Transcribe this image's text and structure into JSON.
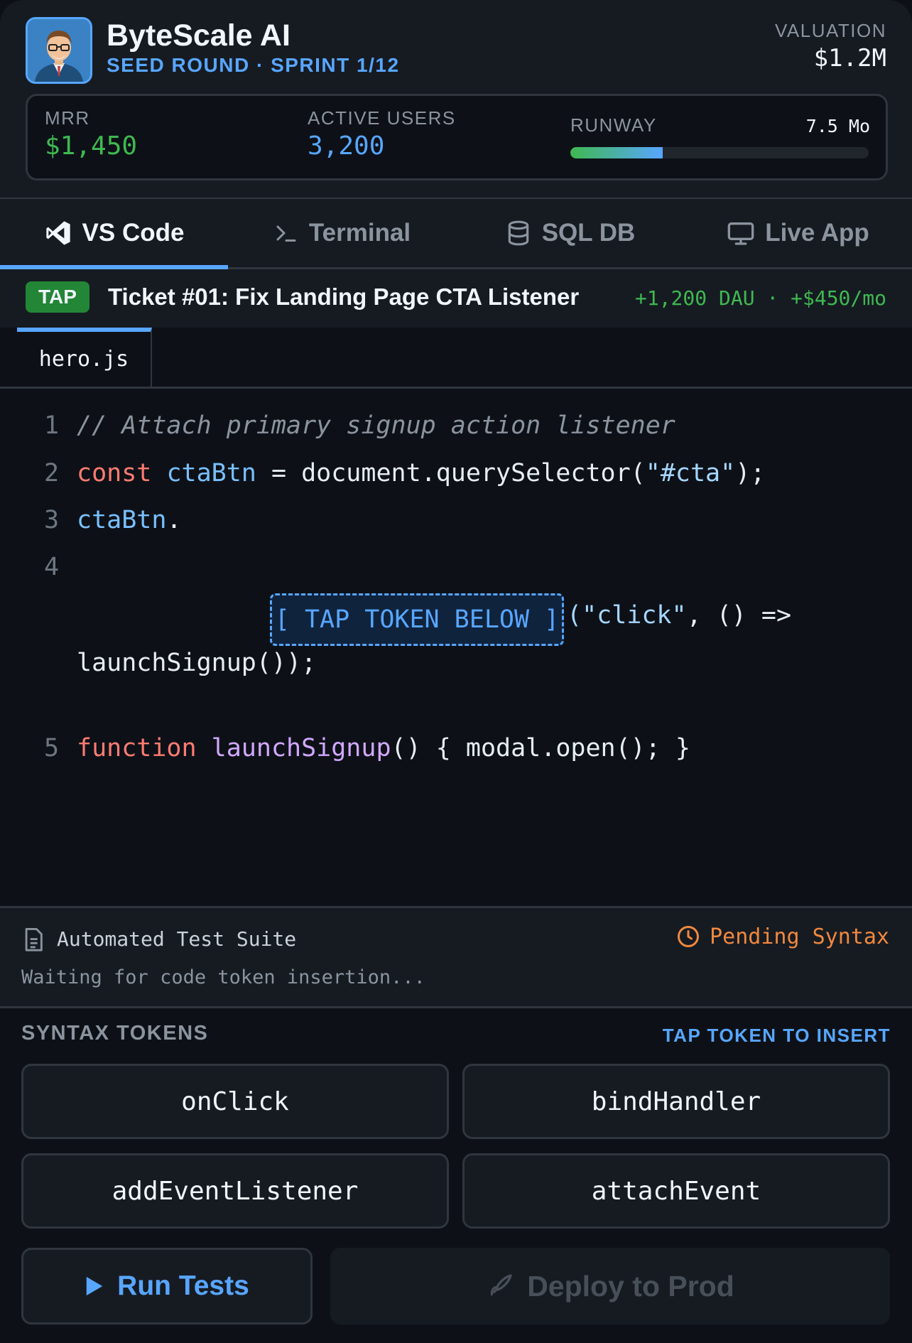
{
  "header": {
    "company_name": "ByteScale AI",
    "round": "SEED ROUND · SPRINT 1/12",
    "valuation_label": "VALUATION",
    "valuation_value": "$1.2M"
  },
  "stats": {
    "mrr_label": "MRR",
    "mrr_value": "$1,450",
    "users_label": "ACTIVE USERS",
    "users_value": "3,200",
    "runway_label": "RUNWAY",
    "runway_value": "7.5 Mo",
    "runway_fill_fraction": 0.31
  },
  "tabs": [
    {
      "label": "VS Code",
      "icon": "vscode-icon",
      "active": true
    },
    {
      "label": "Terminal",
      "icon": "terminal-icon",
      "active": false
    },
    {
      "label": "SQL DB",
      "icon": "database-icon",
      "active": false
    },
    {
      "label": "Live App",
      "icon": "monitor-icon",
      "active": false
    }
  ],
  "ticket": {
    "badge": "TAP",
    "title": "Ticket #01: Fix Landing Page CTA Listener",
    "reward": "+1,200 DAU · +$450/mo"
  },
  "file_tab": "hero.js",
  "code": {
    "line_numbers": [
      "1",
      "2",
      "3",
      "4",
      "5"
    ],
    "line1": "// Attach primary signup action listener",
    "line2": {
      "kw": "const",
      "var": "ctaBtn",
      "op": " = document.querySelector(",
      "str": "\"#cta\"",
      "end": ");"
    },
    "line3": {
      "var": "ctaBtn",
      "end": "."
    },
    "slot_placeholder": "[ TAP TOKEN BELOW ]",
    "line4_after": {
      "str": "(\"click\"",
      "rest": ", () =>"
    },
    "line4_cont": "launchSignup());",
    "line5": {
      "kw": "function",
      "fn": "launchSignup",
      "rest": "() { modal.open(); }"
    }
  },
  "tests": {
    "title": "Automated Test Suite",
    "status": "Pending Syntax",
    "message": "Waiting for code token insertion..."
  },
  "tokens": {
    "heading": "SYNTAX TOKENS",
    "hint": "TAP TOKEN TO INSERT",
    "items": [
      "onClick",
      "bindHandler",
      "addEventListener",
      "attachEvent"
    ]
  },
  "actions": {
    "run_label": "Run Tests",
    "deploy_label": "Deploy to Prod"
  },
  "colors": {
    "accent_blue": "#58a6ff",
    "success_green": "#3fb950",
    "warning_orange": "#f0883e",
    "background": "#0d1117"
  }
}
